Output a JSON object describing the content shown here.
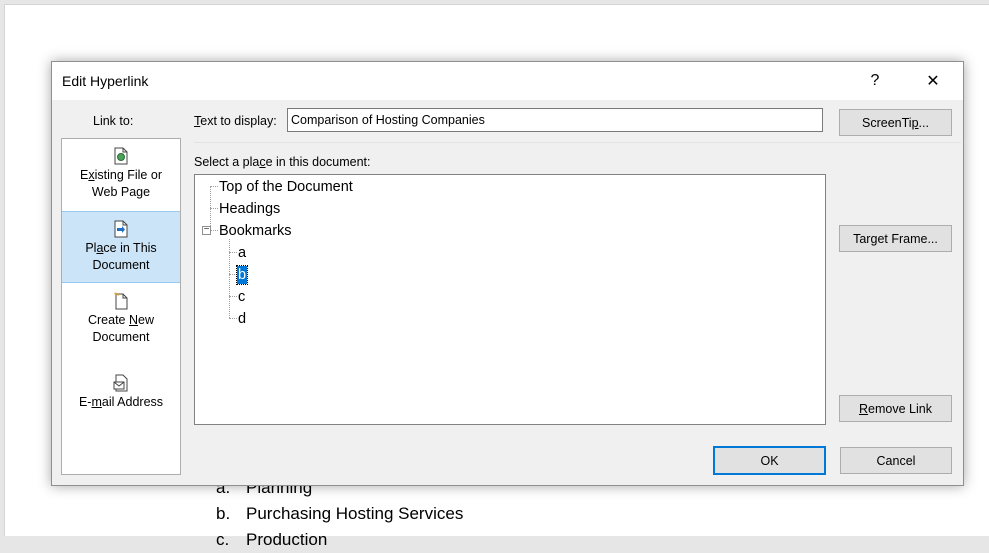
{
  "document": {
    "items": [
      {
        "marker": "a.",
        "text": "Planning"
      },
      {
        "marker": "b.",
        "text": "Purchasing Hosting Services"
      },
      {
        "marker": "c.",
        "text": "Production"
      }
    ]
  },
  "dialog": {
    "title": "Edit Hyperlink",
    "help_label": "?",
    "close_label": "✕",
    "link_to_label": "Link to:",
    "link_to_options": [
      {
        "line1_pre": "E",
        "line1_u": "x",
        "line1_post": "isting File or",
        "line2": "Web Page",
        "icon": "existing-file-icon"
      },
      {
        "line1_pre": "Pl",
        "line1_u": "a",
        "line1_post": "ce in This",
        "line2": "Document",
        "icon": "place-in-document-icon",
        "selected": true
      },
      {
        "line1_pre": "Create ",
        "line1_u": "N",
        "line1_post": "ew",
        "line2": "Document",
        "icon": "new-document-icon"
      },
      {
        "line1_pre": "E-",
        "line1_u": "m",
        "line1_post": "ail Address",
        "line2": "",
        "icon": "email-icon"
      }
    ],
    "text_to_display": {
      "label_u": "T",
      "label_rest": "ext to display:",
      "value": "Comparison of Hosting Companies"
    },
    "select_place": {
      "label_pre": "Select a pla",
      "label_u": "c",
      "label_post": "e in this document:"
    },
    "tree": {
      "top": "Top of the Document",
      "headings": "Headings",
      "bookmarks": "Bookmarks",
      "bookmark_items": [
        "a",
        "b",
        "c",
        "d"
      ],
      "selected_bookmark": "b"
    },
    "buttons": {
      "screentip_pre": "ScreenTi",
      "screentip_u": "p",
      "screentip_post": "...",
      "target_frame_pre": "Tar",
      "target_frame_u": "g",
      "target_frame_post": "et Frame...",
      "remove_link_u": "R",
      "remove_link_post": "emove Link",
      "ok": "OK",
      "cancel": "Cancel"
    }
  }
}
